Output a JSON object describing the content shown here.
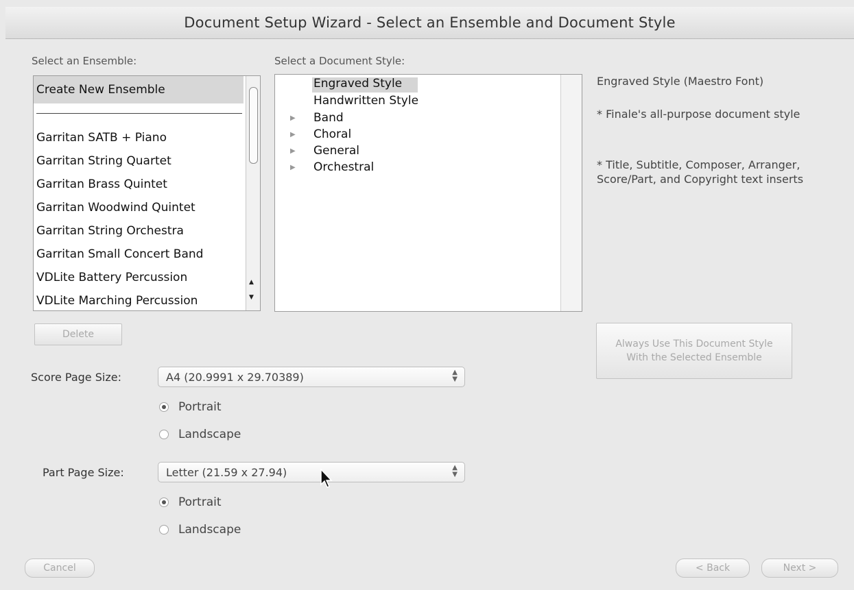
{
  "window": {
    "title": "Document Setup Wizard - Select an Ensemble and Document Style"
  },
  "ensemble": {
    "label": "Select an Ensemble:",
    "selected": "Create New Ensemble",
    "items": [
      "Create New Ensemble",
      "Garritan SATB + Piano",
      "Garritan String Quartet",
      "Garritan Brass Quintet",
      "Garritan Woodwind Quintet",
      "Garritan String Orchestra",
      "Garritan Small Concert Band",
      "VDLite Battery Percussion",
      "VDLite Marching Percussion"
    ],
    "delete_label": "Delete"
  },
  "style": {
    "label": "Select a Document Style:",
    "selected": "Engraved Style",
    "items": [
      {
        "label": "Engraved Style",
        "expandable": false
      },
      {
        "label": "Handwritten Style",
        "expandable": false
      },
      {
        "label": "Band",
        "expandable": true
      },
      {
        "label": "Choral",
        "expandable": true
      },
      {
        "label": "General",
        "expandable": true
      },
      {
        "label": "Orchestral",
        "expandable": true
      }
    ]
  },
  "description": {
    "title": "Engraved Style (Maestro Font)",
    "bullet1": "* Finale's all-purpose document style",
    "bullet2": "* Title, Subtitle, Composer, Arranger, Score/Part, and Copyright text inserts"
  },
  "always_use_button": "Always Use This Document Style With the Selected Ensemble",
  "score": {
    "label": "Score Page Size:",
    "value": "A4 (20.9991 x 29.70389)",
    "portrait": "Portrait",
    "landscape": "Landscape",
    "orientation": "Portrait"
  },
  "part": {
    "label": "Part Page Size:",
    "value": "Letter (21.59 x 27.94)",
    "portrait": "Portrait",
    "landscape": "Landscape",
    "orientation": "Portrait"
  },
  "footer": {
    "cancel": "Cancel",
    "back": "< Back",
    "next": "Next >"
  }
}
